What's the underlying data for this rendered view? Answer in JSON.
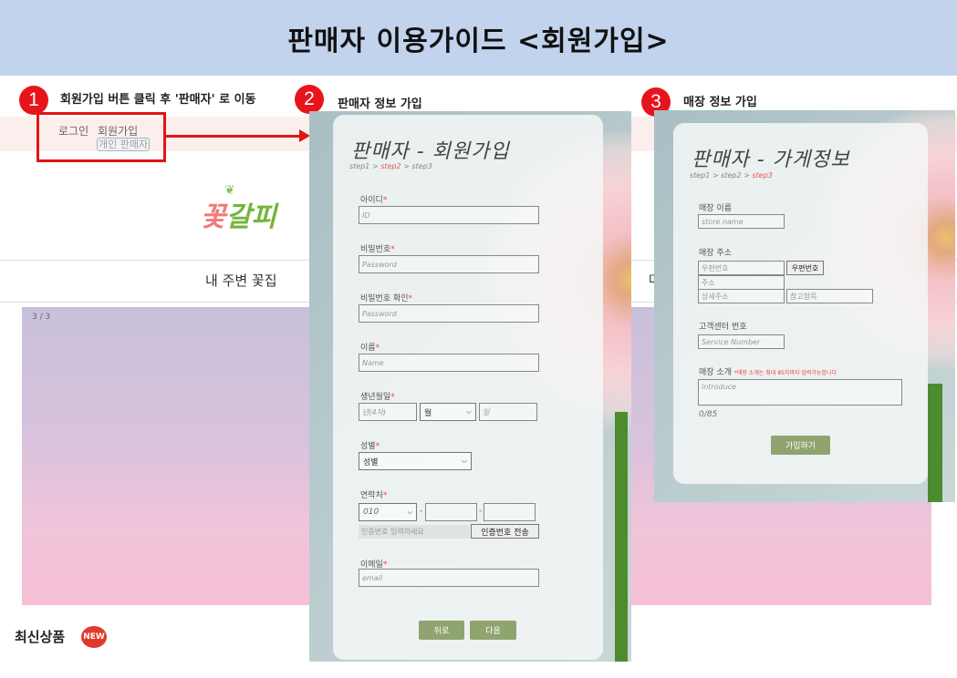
{
  "banner": {
    "title": "판매자 이용가이드 <회원가입>"
  },
  "steps": [
    {
      "num": "1",
      "label": "회원가입 버튼 클릭 후 '판매자' 로 이동"
    },
    {
      "num": "2",
      "label": "판매자 정보 가입"
    },
    {
      "num": "3",
      "label": "매장 정보 가입"
    }
  ],
  "site": {
    "login": "로그인",
    "join": "회원가입",
    "seller": "개인 판매자",
    "logo_a": "꽃",
    "logo_b": "갈피",
    "nav_item": "내 주변 꽃집",
    "nav_item2": "마",
    "hero_index": "3 / 3",
    "newest": "최신상품",
    "new_badge": "NEW"
  },
  "member_form": {
    "title": "판매자 - 회원가입",
    "crumb": {
      "s1": "step1 > ",
      "s2": "step2",
      "s3": " > step3"
    },
    "id_label": "아이디",
    "id_ph": "ID",
    "pw_label": "비밀번호",
    "pw_ph": "Password",
    "pw2_label": "비밀번호 확인",
    "pw2_ph": "Password",
    "name_label": "이름",
    "name_ph": "Name",
    "birth_label": "생년월일",
    "year_ph": "년(4자)",
    "month": "월",
    "day_ph": "일",
    "gender_label": "성별",
    "gender": "성별",
    "phone_label": "연락처",
    "phone_prefix": "010",
    "dash": "-",
    "code_ph": "인증번호 입력하세요",
    "send_code": "인증번호 전송",
    "email_label": "이메일",
    "email_ph": "email",
    "back": "뒤로",
    "next": "다음",
    "req": "*"
  },
  "store_form": {
    "title": "판매자 - 가게정보",
    "crumb": {
      "s1": "step1 > step2 > ",
      "s3": "step3"
    },
    "store_name_label": "매장 이름",
    "store_name_ph": "store name",
    "addr_label": "매장 주소",
    "zip_ph": "우편번호",
    "zip_btn": "우편번호",
    "addr_ph": "주소",
    "detail_ph": "상세주소",
    "ref_ph": "참고항목",
    "service_label": "고객센터 번호",
    "service_ph": "Service Number",
    "intro_label": "매장 소개",
    "intro_note": "*매장 소개는 최대 85자까지 입력가능합니다",
    "intro_ph": "introduce",
    "counter": "0/85",
    "submit": "가입하기"
  },
  "colors": {
    "accent_red": "#e8141c",
    "button_green": "#8fa46e",
    "banner": "#c2d3ee"
  }
}
